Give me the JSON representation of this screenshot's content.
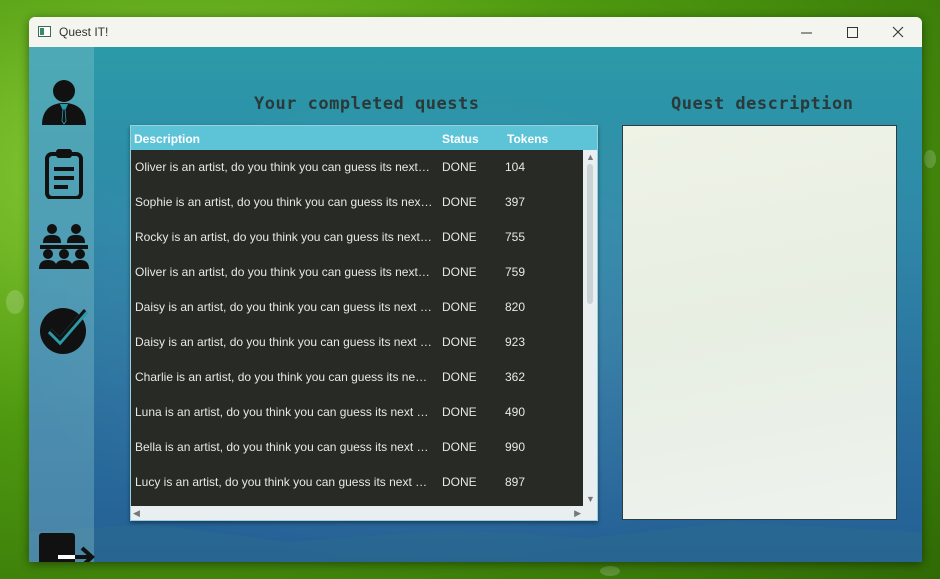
{
  "window": {
    "title": "Quest IT!",
    "controls": [
      "minimize",
      "maximize",
      "close"
    ]
  },
  "sidebar": {
    "items": [
      {
        "icon": "user-profile-icon"
      },
      {
        "icon": "clipboard-list-icon"
      },
      {
        "icon": "community-group-icon"
      },
      {
        "icon": "completed-check-icon"
      }
    ],
    "exit_icon": "logout-icon"
  },
  "completed_quests": {
    "heading": "Your completed quests",
    "columns": {
      "description": "Description",
      "status": "Status",
      "tokens": "Tokens"
    },
    "rows": [
      {
        "description": "Oliver is an artist, do you think you can guess its next move?",
        "status": "DONE",
        "tokens": "104"
      },
      {
        "description": "Sophie is an artist, do you think you can guess its next move?",
        "status": "DONE",
        "tokens": "397"
      },
      {
        "description": "Rocky is an artist, do you think you can guess its next move?",
        "status": "DONE",
        "tokens": "755"
      },
      {
        "description": "Oliver is an artist, do you think you can guess its next move?",
        "status": "DONE",
        "tokens": "759"
      },
      {
        "description": "Daisy is an artist, do you think you can guess its next move?",
        "status": "DONE",
        "tokens": "820"
      },
      {
        "description": "Daisy is an artist, do you think you can guess its next move?",
        "status": "DONE",
        "tokens": "923"
      },
      {
        "description": "Charlie is an artist, do you think you can guess its next move?",
        "status": "DONE",
        "tokens": "362"
      },
      {
        "description": "Luna is an artist, do you think you can guess its next move?",
        "status": "DONE",
        "tokens": "490"
      },
      {
        "description": "Bella is an artist, do you think you can guess its next move?",
        "status": "DONE",
        "tokens": "990"
      },
      {
        "description": "Lucy is an artist, do you think you can guess its next move?",
        "status": "DONE",
        "tokens": "897"
      }
    ]
  },
  "quest_description": {
    "heading": "Quest description",
    "text": ""
  },
  "colors": {
    "header": "#5dc4d8",
    "table_bg": "#282a26",
    "background": "#2f88a8"
  }
}
